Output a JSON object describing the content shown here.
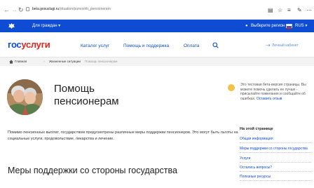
{
  "browser": {
    "url_host": "beta.gosuslugi.ru",
    "url_path": "/situation/pomoshh_pensioneram"
  },
  "gov_strip": {
    "for_citizens": "Для граждан",
    "region": "Выберите регион",
    "language": "RUS"
  },
  "header": {
    "logo_part1": "гос",
    "logo_part2": "услуги",
    "menu": [
      "Каталог услуг",
      "Помощь и поддержка",
      "Оплата"
    ],
    "cabinet": "Личный кабинет"
  },
  "breadcrumb": [
    "Главная",
    "Жизненные ситуации",
    "Помощь пенсионерам"
  ],
  "page": {
    "title": "Помощь пенсионерам",
    "beta_notice": "Это тестовая бета-версия страницы. Вы можете помочь сделать ее лучше - присылайте пожелания и сообщайте об ошибках.",
    "beta_link": "Оставить отзыв",
    "intro": "Помимо пенсионных выплат, государством предусмотрены различные меры поддержки пенсионеров. Это могут быть льготы на социальные услуги, продовольствие, лекарства и лечение.",
    "section_title": "Меры поддержки со стороны государства"
  },
  "toc": {
    "title": "На этой странице",
    "items": [
      "Общая информация",
      "Меры поддержки со стороны государства",
      "Услуги",
      "Остались вопросы?",
      "Полезные ресурсы"
    ]
  },
  "colors": {
    "brand_blue": "#0d4cd3",
    "brand_red": "#e1251b",
    "beta_yellow": "#f3c146"
  }
}
